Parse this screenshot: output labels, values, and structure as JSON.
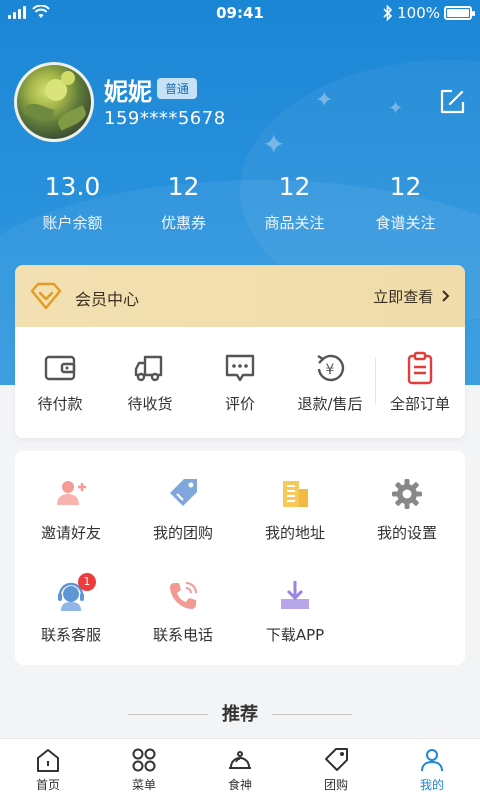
{
  "status_bar": {
    "time": "09:41",
    "battery": "100%"
  },
  "profile": {
    "name": "妮妮",
    "level": "普通",
    "phone": "159****5678"
  },
  "stats": [
    {
      "value": "13.0",
      "label": "账户余额"
    },
    {
      "value": "12",
      "label": "优惠券"
    },
    {
      "value": "12",
      "label": "商品关注"
    },
    {
      "value": "12",
      "label": "食谱关注"
    }
  ],
  "vip": {
    "title": "会员中心",
    "link": "立即查看"
  },
  "orders": [
    {
      "label": "待付款",
      "icon": "wallet-icon"
    },
    {
      "label": "待收货",
      "icon": "truck-icon"
    },
    {
      "label": "评价",
      "icon": "comment-icon"
    },
    {
      "label": "退款/售后",
      "icon": "refund-icon"
    },
    {
      "label": "全部订单",
      "icon": "clipboard-icon"
    }
  ],
  "services": [
    {
      "label": "邀请好友",
      "icon": "add-user-icon"
    },
    {
      "label": "我的团购",
      "icon": "tag-icon"
    },
    {
      "label": "我的地址",
      "icon": "building-icon"
    },
    {
      "label": "我的设置",
      "icon": "gear-icon"
    },
    {
      "label": "联系客服",
      "icon": "headset-icon",
      "badge": "1"
    },
    {
      "label": "联系电话",
      "icon": "phone-icon"
    },
    {
      "label": "下载APP",
      "icon": "download-icon"
    }
  ],
  "recommend": {
    "title": "推荐"
  },
  "tabbar": [
    {
      "label": "首页",
      "icon": "home-icon"
    },
    {
      "label": "菜单",
      "icon": "menu-grid-icon"
    },
    {
      "label": "食神",
      "icon": "chef-icon"
    },
    {
      "label": "团购",
      "icon": "group-buy-icon"
    },
    {
      "label": "我的",
      "icon": "user-icon",
      "active": true
    }
  ],
  "colors": {
    "primary": "#1b86d6",
    "vip_bg": "#f3e0b2",
    "accent_red": "#e23b3b"
  }
}
